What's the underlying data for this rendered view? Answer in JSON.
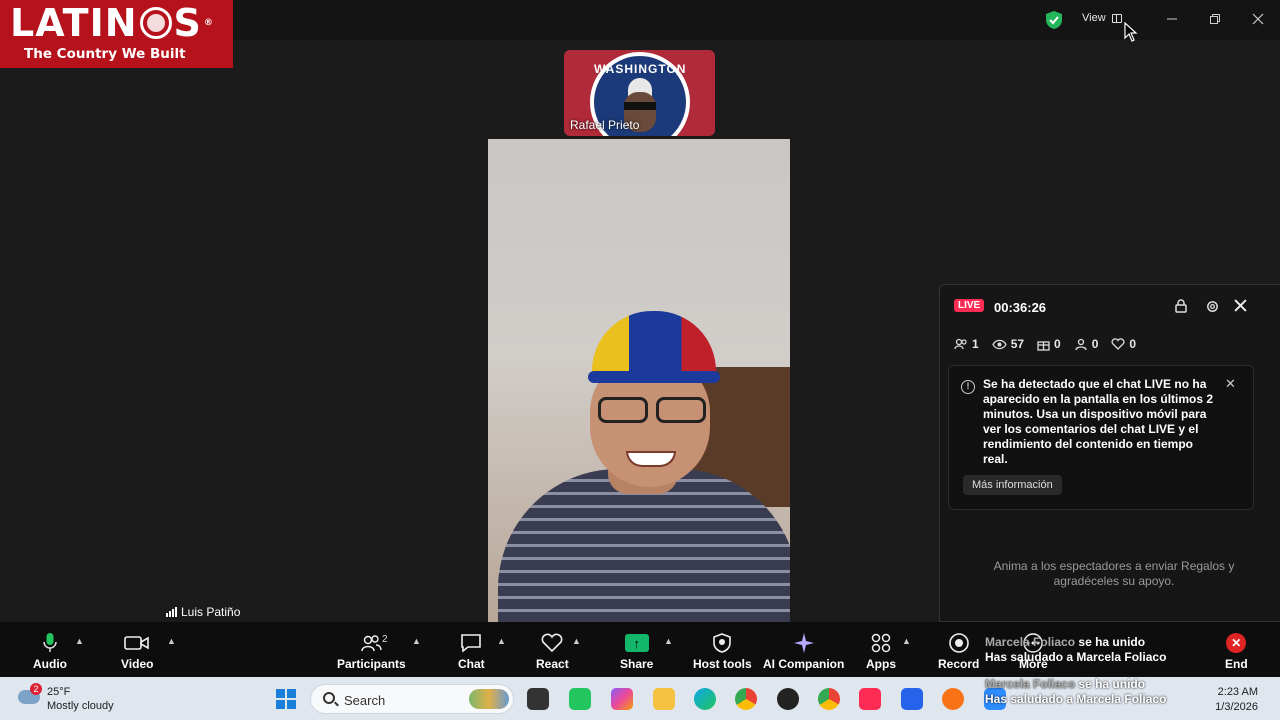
{
  "logo": {
    "brand": "LATIN",
    "brand_end": "S",
    "reg": "®",
    "tagline": "The Country We Built"
  },
  "titlebar": {
    "view_label": "View"
  },
  "thumbnail": {
    "name": "Rafael Prieto",
    "badge_text": "WASHINGTON"
  },
  "speaker": {
    "name": "Luis Patiño"
  },
  "live_panel": {
    "badge": "LIVE",
    "timer": "00:36:26",
    "stats": {
      "members": "1",
      "viewers": "57",
      "gifts": "0",
      "shares": "0",
      "likes": "0"
    },
    "notice_text": "Se ha detectado que el chat LIVE no ha aparecido en la pantalla en los últimos 2 minutos. Usa un dispositivo móvil para ver los comentarios del chat LIVE y el rendimiento del contenido en tiempo real.",
    "notice_button": "Más información",
    "prompt": "Anima a los espectadores a enviar Regalos y agradéceles su apoyo."
  },
  "toolbar": {
    "audio": "Audio",
    "video": "Video",
    "participants": "Participants",
    "participants_count": "2",
    "chat": "Chat",
    "react": "React",
    "share": "Share",
    "host_tools": "Host tools",
    "ai_companion": "AI Companion",
    "apps": "Apps",
    "record": "Record",
    "more": "More",
    "end": "End"
  },
  "overlay": {
    "join_name": "Marcela Foliaco",
    "join_text": "se ha unido",
    "greet_text": "Has saludado a Marcela Foliaco"
  },
  "taskbar": {
    "weather_temp": "25°F",
    "weather_desc": "Mostly cloudy",
    "weather_badge": "2",
    "search_placeholder": "Search",
    "time": "2:23 AM",
    "date": "1/3/2026"
  },
  "colors": {
    "live_accent": "#fe2c55",
    "share_green": "#12b76a",
    "end_red": "#e02424",
    "logo_red": "#b5121b"
  }
}
